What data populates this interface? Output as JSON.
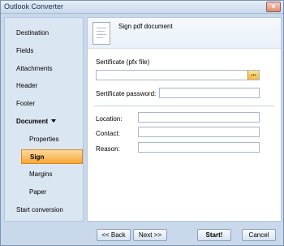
{
  "window": {
    "title": "Outlook Converter"
  },
  "sidebar": {
    "items": [
      {
        "label": "Destination"
      },
      {
        "label": "Fields"
      },
      {
        "label": "Attachments"
      },
      {
        "label": "Header"
      },
      {
        "label": "Footer"
      },
      {
        "label": "Document"
      },
      {
        "label": "Properties"
      },
      {
        "label": "Sign"
      },
      {
        "label": "Margins"
      },
      {
        "label": "Paper"
      },
      {
        "label": "Start conversion"
      }
    ]
  },
  "content": {
    "header_title": "Sign pdf document",
    "certificate_label": "Sertificate (pfx file)",
    "certificate_placeholder": "",
    "browse_label": "...",
    "password_label": "Sertificate password:",
    "location_label": "Location:",
    "contact_label": "Contact:",
    "reason_label": "Reason:"
  },
  "buttons": {
    "back": "<< Back",
    "next": "Next >>",
    "start": "Start!",
    "cancel": "Cancel"
  },
  "icons": {
    "document": "document-icon",
    "close": "close-icon",
    "caret": "caret-down-icon"
  },
  "colors": {
    "accent": "#f6a637",
    "panel": "#dbe6f3",
    "window": "#c9d8ea"
  }
}
